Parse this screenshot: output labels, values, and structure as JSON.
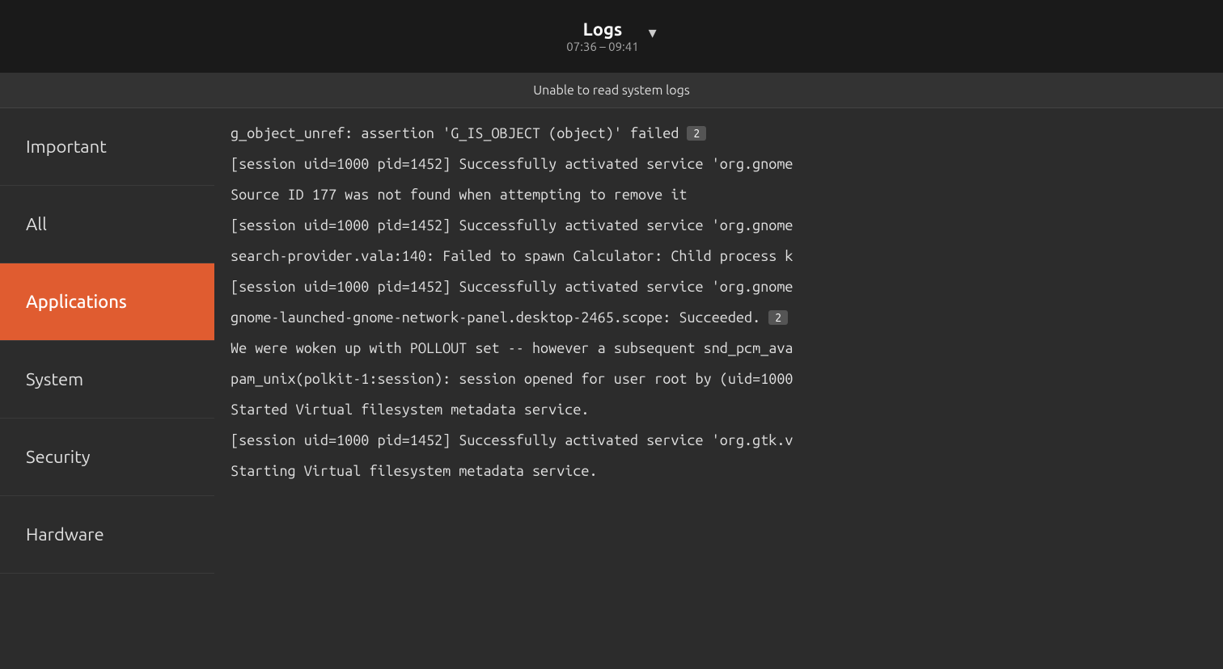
{
  "header": {
    "title": "Logs",
    "time_range": "07:36 – 09:41",
    "dropdown_icon": "▾"
  },
  "status": {
    "message": "Unable to read system logs"
  },
  "sidebar": {
    "items": [
      {
        "id": "important",
        "label": "Important",
        "active": false
      },
      {
        "id": "all",
        "label": "All",
        "active": false
      },
      {
        "id": "applications",
        "label": "Applications",
        "active": true
      },
      {
        "id": "system",
        "label": "System",
        "active": false
      },
      {
        "id": "security",
        "label": "Security",
        "active": false
      },
      {
        "id": "hardware",
        "label": "Hardware",
        "active": false
      }
    ]
  },
  "logs": {
    "lines": [
      {
        "text": "g_object_unref: assertion 'G_IS_OBJECT (object)' failed",
        "badge": "2"
      },
      {
        "text": "[session uid=1000 pid=1452] Successfully activated service 'org.gnome",
        "badge": null
      },
      {
        "text": "Source ID 177 was not found when attempting to remove it",
        "badge": null
      },
      {
        "text": "[session uid=1000 pid=1452] Successfully activated service 'org.gnome",
        "badge": null
      },
      {
        "text": "search-provider.vala:140: Failed to spawn Calculator: Child process k",
        "badge": null
      },
      {
        "text": "[session uid=1000 pid=1452] Successfully activated service 'org.gnome",
        "badge": null
      },
      {
        "text": "gnome-launched-gnome-network-panel.desktop-2465.scope: Succeeded.",
        "badge": "2"
      },
      {
        "text": "We were woken up with POLLOUT set -- however a subsequent snd_pcm_ava",
        "badge": null
      },
      {
        "text": "pam_unix(polkit-1:session): session opened for user root by (uid=1000",
        "badge": null
      },
      {
        "text": "Started Virtual filesystem metadata service.",
        "badge": null
      },
      {
        "text": "[session uid=1000 pid=1452] Successfully activated service 'org.gtk.v",
        "badge": null
      },
      {
        "text": "Starting Virtual filesystem metadata service.",
        "badge": null
      }
    ]
  }
}
